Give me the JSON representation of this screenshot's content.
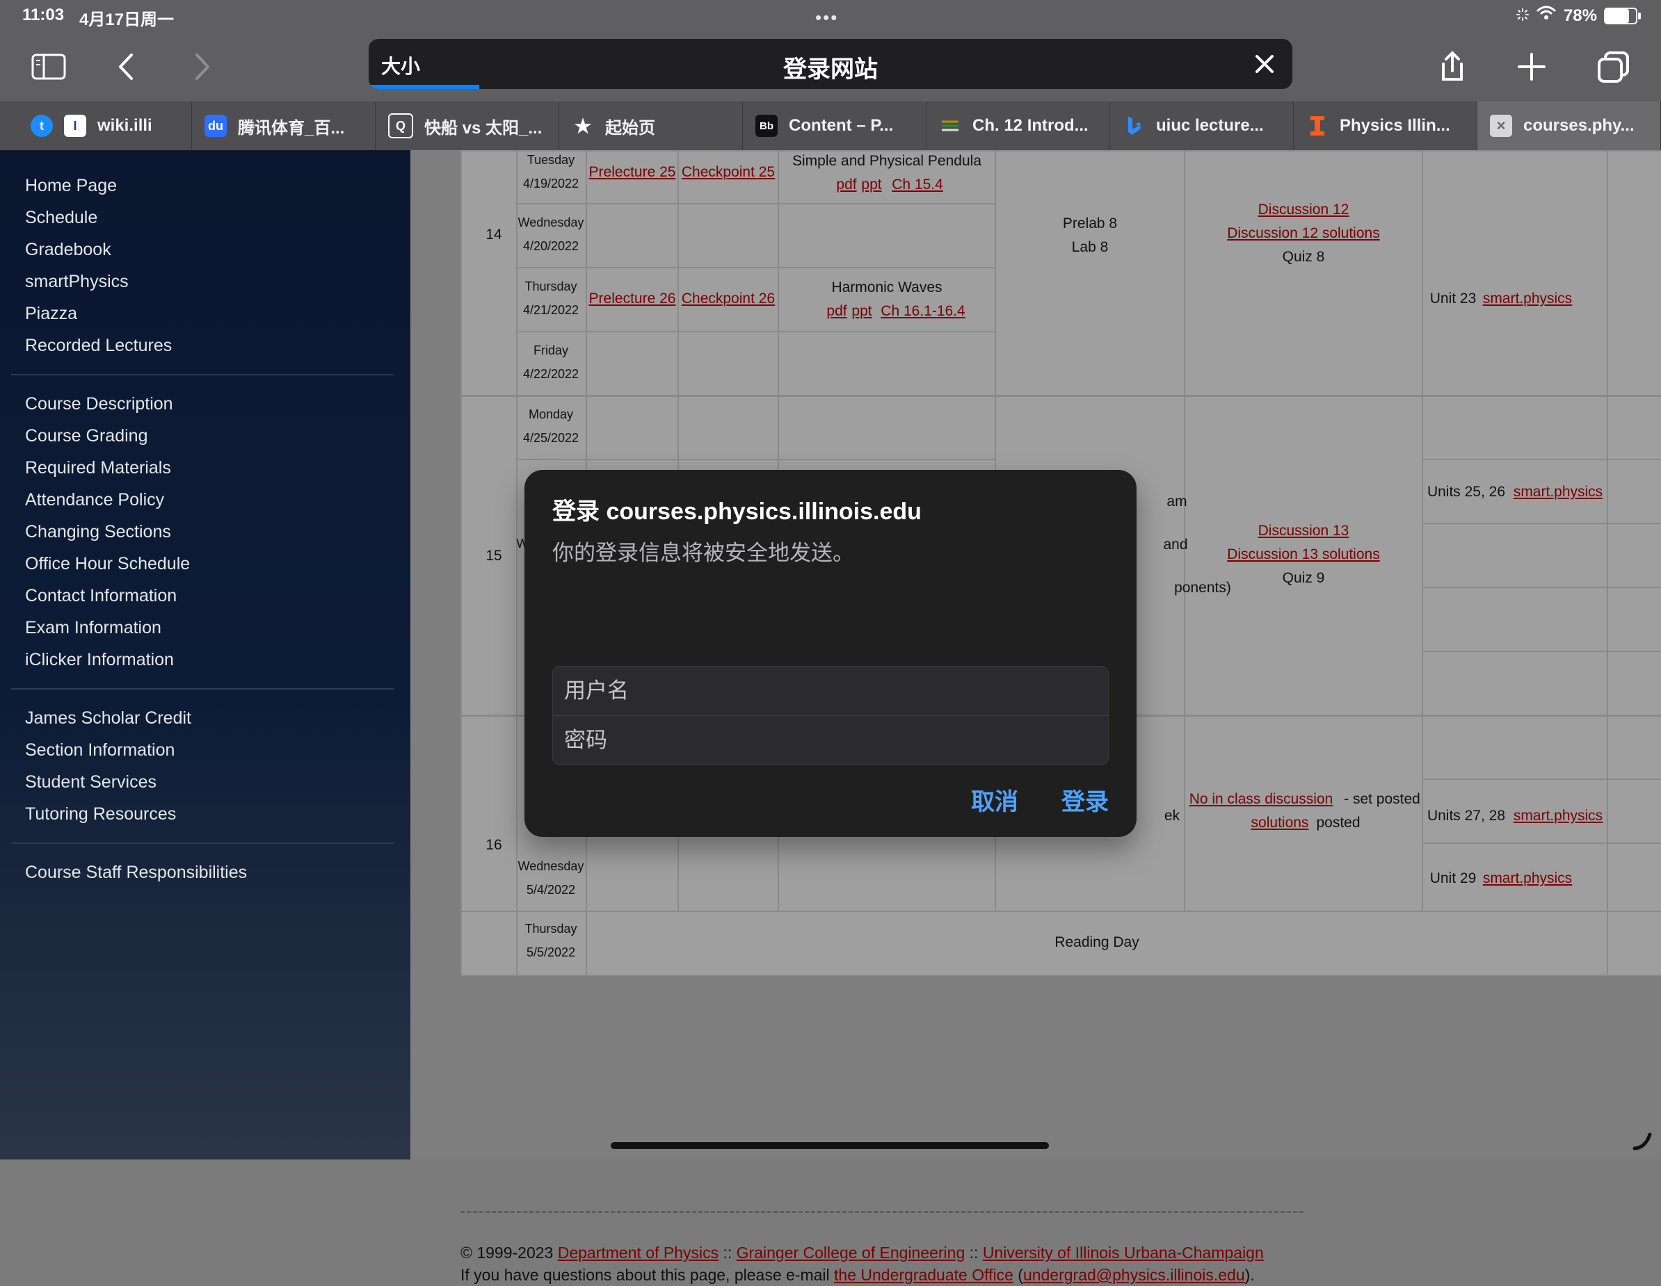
{
  "status": {
    "time": "11:03",
    "date": "4月17日周一",
    "dots": "•••",
    "battery": "78%",
    "battery_fill_percent": 78
  },
  "browser": {
    "text_size_label": "大小",
    "address_title": "登录网站",
    "progress_percent": 12
  },
  "tabs": [
    {
      "label": "wiki.illi"
    },
    {
      "label": "腾讯体育_百..."
    },
    {
      "label": "快船 vs 太阳_..."
    },
    {
      "label": "起始页"
    },
    {
      "label": "Content – P..."
    },
    {
      "label": "Ch. 12 Introd..."
    },
    {
      "label": "uiuc lecture..."
    },
    {
      "label": "Physics Illin..."
    },
    {
      "label": "courses.phy..."
    }
  ],
  "sidebar": {
    "group1": [
      "Home Page",
      "Schedule",
      "Gradebook",
      "smartPhysics",
      "Piazza",
      "Recorded Lectures"
    ],
    "group2": [
      "Course Description",
      "Course Grading",
      "Required Materials",
      "Attendance Policy",
      "Changing Sections",
      "Office Hour Schedule",
      "Contact Information",
      "Exam Information",
      "iClicker Information"
    ],
    "group3": [
      "James Scholar Credit",
      "Section Information",
      "Student Services",
      "Tutoring Resources"
    ],
    "group4": [
      "Course Staff Responsibilities"
    ]
  },
  "schedule": {
    "weeks": {
      "w14": "14",
      "w15": "15",
      "w16": "16"
    },
    "rows": {
      "tue_day": "Tuesday",
      "tue_date": "4/19/2022",
      "wed_day": "Wednesday",
      "wed_date": "4/20/2022",
      "thu_day": "Thursday",
      "thu_date": "4/21/2022",
      "fri_day": "Friday",
      "fri_date": "4/22/2022",
      "mon_day": "Monday",
      "mon_date": "4/25/2022",
      "wed2_day": "Wednesday",
      "wed2_date": "5/4/2022",
      "thu2_day": "Thursday",
      "thu2_date": "5/5/2022"
    },
    "texts": {
      "prelecture25": "Prelecture 25",
      "checkpoint25": "Checkpoint 25",
      "topic1": "Simple and Physical Pendula",
      "pdf1": "pdf",
      "ppt1": "ppt",
      "ch1": "Ch 15.4",
      "prelab8": "Prelab 8",
      "lab8": "Lab 8",
      "disc12": "Discussion 12",
      "disc12sol": "Discussion 12 solutions",
      "quiz8": "Quiz 8",
      "prelecture26": "Prelecture 26",
      "checkpoint26": "Checkpoint 26",
      "topic2": "Harmonic Waves",
      "pdf2": "pdf",
      "ppt2": "ppt",
      "ch2": "Ch 16.1-16.4",
      "unit23": "Unit 23",
      "smart1": "smart.physics",
      "units2526": "Units 25, 26",
      "smart2": "smart.physics",
      "disc13": "Discussion 13",
      "disc13sol": "Discussion 13 solutions",
      "quiz9": "Quiz 9",
      "partial_am": "am",
      "partial_and": "and",
      "partial_ponents": "ponents)",
      "partial_w": "W",
      "no_class": "No in class discussion",
      "set_posted": "- set posted",
      "solutions": "solutions",
      "posted": "posted",
      "partial_ek": "ek",
      "units2728": "Units 27, 28",
      "smart3": "smart.physics",
      "unit29": "Unit 29",
      "smart4": "smart.physics",
      "reading_day": "Reading Day"
    }
  },
  "footer": {
    "copyright": "© 1999-2023",
    "dept": "Department of Physics",
    "sep1": "::",
    "college": "Grainger College of Engineering",
    "sep2": "::",
    "university": "University of Illinois Urbana-Champaign",
    "question_prefix": "If you have questions about this page, please e-mail",
    "office": "the Undergraduate Office",
    "paren_open": "(",
    "email": "undergrad@physics.illinois.edu",
    "paren_close": ")."
  },
  "dialog": {
    "title": "登录 courses.physics.illinois.edu",
    "subtitle": "你的登录信息将被安全地发送。",
    "username_placeholder": "用户名",
    "password_placeholder": "密码",
    "cancel": "取消",
    "login": "登录"
  },
  "colors": {
    "link": "#7a0000",
    "dialog_button": "#4ea3ff",
    "sidebar_top": "#0b1730"
  }
}
